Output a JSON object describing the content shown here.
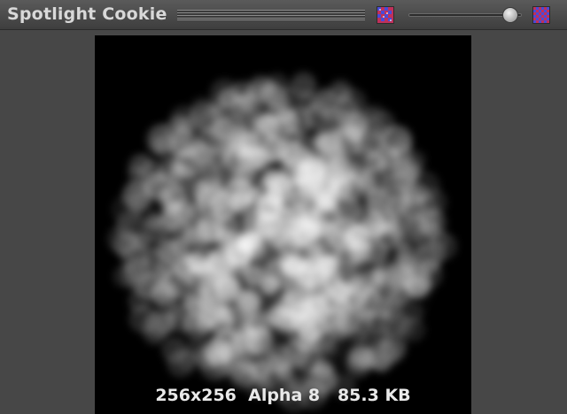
{
  "window": {
    "title": "Spotlight Cookie"
  },
  "toolbar": {
    "alpha_toggle_icon": "alpha-checker-icon",
    "rgb_toggle_icon": "rgb-checker-icon",
    "mip_slider_value": 0.9
  },
  "preview": {
    "info_text": "256x256  Alpha 8   85.3 KB"
  },
  "colors": {
    "background": "#474747",
    "preview_bg": "#000000",
    "checker_blue": "#4a4ad8",
    "checker_red": "#c0305a"
  }
}
